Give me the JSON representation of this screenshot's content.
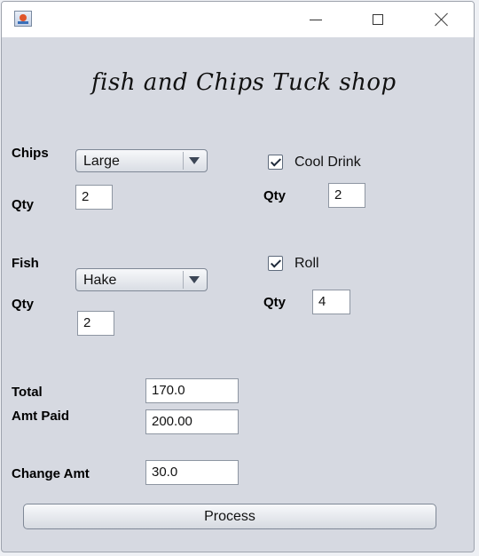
{
  "window": {
    "controls": {
      "minimize_icon": "minimize-icon",
      "maximize_icon": "maximize-icon",
      "close_icon": "close-icon",
      "app_icon": "java-app-icon"
    }
  },
  "heading": "fish and Chips Tuck shop",
  "chips": {
    "label": "Chips",
    "selected": "Large",
    "qty_label": "Qty",
    "qty": "2"
  },
  "fish": {
    "label": "Fish",
    "selected": "Hake",
    "qty_label": "Qty",
    "qty": "2"
  },
  "cool_drink": {
    "label": "Cool Drink",
    "checked": true,
    "qty_label": "Qty",
    "qty": "2"
  },
  "roll": {
    "label": "Roll",
    "checked": true,
    "qty_label": "Qty",
    "qty": "4"
  },
  "totals": {
    "total_label": "Total",
    "total_value": "170.0",
    "paid_label": "Amt Paid",
    "paid_value": "200.00",
    "change_label": "Change Amt",
    "change_value": "30.0"
  },
  "process_label": "Process"
}
